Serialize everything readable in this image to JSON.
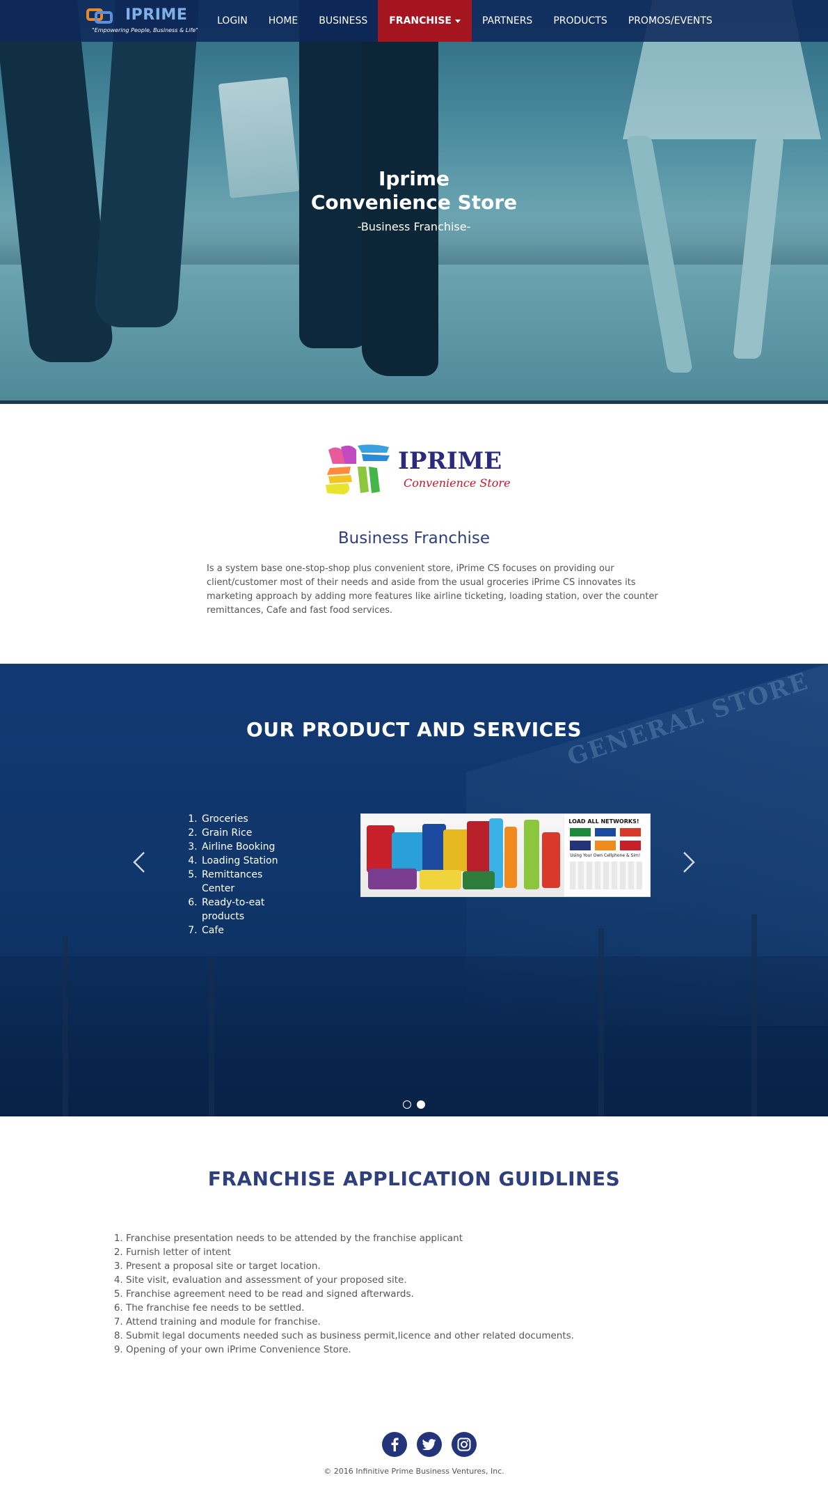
{
  "nav": {
    "brand_name": "IPRIME",
    "brand_tagline": "\"Empowering People, Business & Life\"",
    "items": [
      {
        "label": "LOGIN",
        "active": false
      },
      {
        "label": "HOME",
        "active": false
      },
      {
        "label": "BUSINESS",
        "active": false
      },
      {
        "label": "FRANCHISE",
        "active": true,
        "dropdown": true
      },
      {
        "label": "PARTNERS",
        "active": false
      },
      {
        "label": "PRODUCTS",
        "active": false
      },
      {
        "label": "PROMOS/EVENTS",
        "active": false
      }
    ]
  },
  "hero": {
    "title_line1": "Iprime",
    "title_line2": "Convenience Store",
    "subtitle": "-Business Franchise-"
  },
  "intro": {
    "logo_text": "IPRIME",
    "logo_sub": "Convenience Store",
    "heading": "Business Franchise",
    "body": "Is a system base one-stop-shop plus convenient store, iPrime CS focuses on providing our client/customer most of their needs and aside from the usual groceries iPrime CS innovates its marketing approach by adding more features like airline ticketing, loading station, over the counter remittances, Cafe and fast food services."
  },
  "products": {
    "title": "OUR PRODUCT AND SERVICES",
    "sign_text": "GENERAL STORE",
    "services": [
      "Groceries",
      "Grain Rice",
      "Airline Booking",
      "Loading Station",
      "Remittances Center",
      "Ready-to-eat products",
      "Cafe"
    ],
    "load_panel_title": "LOAD ALL NETWORKS!",
    "load_panel_foot": "Using Your Own Cellphone & Sim!",
    "slide_count": 2,
    "active_slide": 2
  },
  "guidelines": {
    "title": "FRANCHISE APPLICATION GUIDLINES",
    "items": [
      "Franchise presentation needs to be attended by the franchise applicant",
      "Furnish letter of intent",
      "Present a proposal site or target location.",
      "Site visit, evaluation and assessment of your proposed site.",
      "Franchise agreement need to be read and signed afterwards.",
      "The franchise fee needs to be settled.",
      "Attend training and module for franchise.",
      "Submit legal documents needed such as business permit,licence and other related documents.",
      "Opening of your own iPrime Convenience Store."
    ]
  },
  "footer": {
    "social": [
      "facebook-icon",
      "twitter-icon",
      "instagram-icon"
    ],
    "copyright": "© 2016 Infinitive Prime Business Ventures, Inc."
  },
  "colors": {
    "nav_bg": "#0e285a",
    "active_nav": "#a5151f",
    "heading_blue": "#2e3f7c",
    "products_bg": "#123a73"
  }
}
